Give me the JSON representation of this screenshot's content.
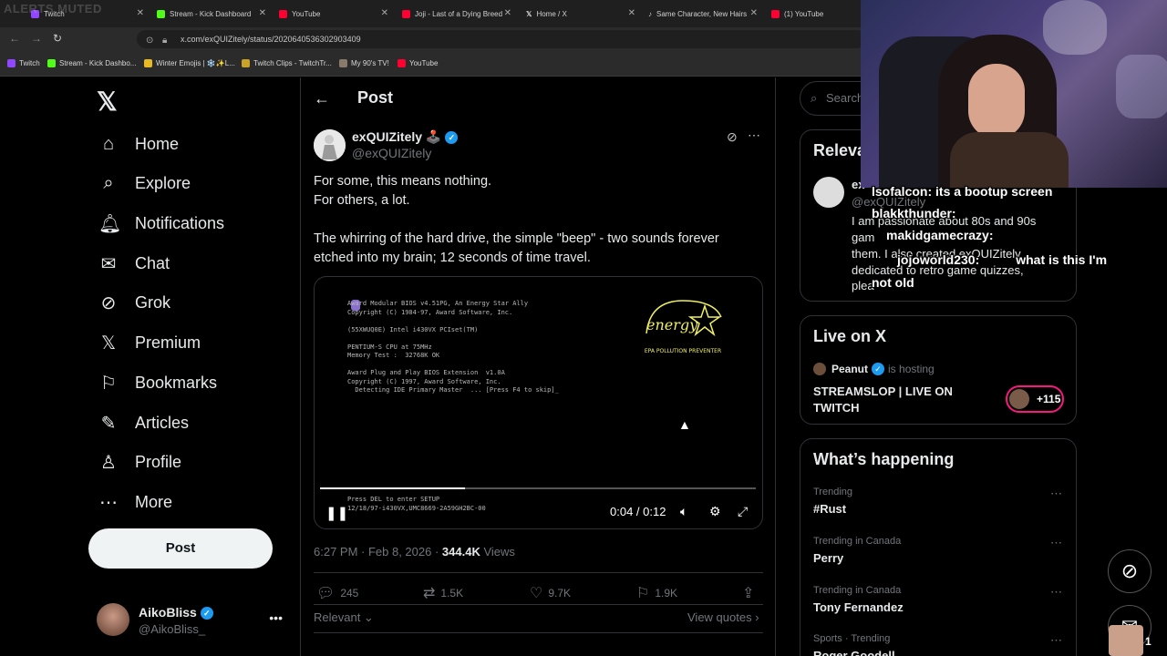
{
  "browser": {
    "tabs": [
      {
        "title": "Twitch",
        "color": "#9146ff"
      },
      {
        "title": "Stream - Kick Dashboard",
        "color": "#53fc18"
      },
      {
        "title": "YouTube",
        "color": "#ff0033"
      },
      {
        "title": "Joji - Last of a Dying Breed",
        "color": "#ff0033"
      },
      {
        "title": "Home / X",
        "color": "#e7e9ea"
      },
      {
        "title": "Same Character, New Hairs",
        "color": "#e7e9ea"
      },
      {
        "title": "(1) YouTube",
        "color": "#ff0033"
      }
    ],
    "url": "x.com/exQUIZitely/status/2020640536302903409",
    "bookmarks": [
      "Twitch",
      "Stream - Kick Dashbo...",
      "Winter Emojis | ❄️✨L...",
      "Twitch Clips - TwitchTr...",
      "My 90's TV!",
      "YouTube"
    ]
  },
  "overlay": {
    "alerts_muted": "ALERTS MUTED",
    "chat": [
      {
        "user": "lsofalcon:",
        "text": " its a bootup screen"
      },
      {
        "user": "blakkthunder:",
        "text": ""
      },
      {
        "user": "makidgamecrazy:",
        "text": ""
      },
      {
        "user": "jojoworld230:",
        "text": "what is this I'm"
      },
      {
        "user": "",
        "text": "not old"
      }
    ],
    "pip_count": "1"
  },
  "nav": {
    "items": [
      {
        "label": "Home",
        "icon": "⌂"
      },
      {
        "label": "Explore",
        "icon": "⌕"
      },
      {
        "label": "Notifications",
        "icon": "🔔︎"
      },
      {
        "label": "Chat",
        "icon": "✉"
      },
      {
        "label": "Grok",
        "icon": "⊘"
      },
      {
        "label": "Premium",
        "icon": "𝕏"
      },
      {
        "label": "Bookmarks",
        "icon": "⚐"
      },
      {
        "label": "Articles",
        "icon": "✎"
      },
      {
        "label": "Profile",
        "icon": "♙"
      },
      {
        "label": "More",
        "icon": "⋯"
      }
    ],
    "post_button": "Post",
    "account": {
      "name": "AikoBliss",
      "handle": "@AikoBliss_"
    }
  },
  "post": {
    "header_title": "Post",
    "author_name": "exQUIZitely 🕹️",
    "author_handle": "@exQUIZitely",
    "lines": [
      "For some, this means nothing.",
      "For others, a lot.",
      "The whirring of the hard drive, the simple \"beep\" - two sounds forever",
      "etched into my brain; 12 seconds of time travel."
    ],
    "video": {
      "bios_top": "Award Modular BIOS v4.51PG, An Energy Star Ally\nCopyright (C) 1984-97, Award Software, Inc.\n\n(55XWUQ0E) Intel i430VX PCIset(TM)\n\nPENTIUM-S CPU at 75MHz\nMemory Test :  32768K OK\n\nAward Plug and Play BIOS Extension  v1.0A\nCopyright (C) 1997, Award Software, Inc.\n  Detecting IDE Primary Master  ... [Press F4 to skip]_",
      "bios_bottom": "Press DEL to enter SETUP\n12/18/97-i430VX,UMC8669-2A59GH2BC-00",
      "energy_label": "EPA POLLUTION PREVENTER",
      "time": "0:04 / 0:12",
      "progress": 0.3333
    },
    "timestamp": "6:27 PM · Feb 8, 2026 · ",
    "views_count": "344.4K",
    "views_label": " Views",
    "actions": {
      "replies": "245",
      "reposts": "1.5K",
      "likes": "9.7K",
      "bookmarks": "1.9K"
    },
    "relevant_label": "Relevant",
    "view_quotes": "View quotes"
  },
  "right": {
    "search_placeholder": "Search",
    "relevant_title": "Relevan",
    "relevant_person": {
      "name": "ex",
      "handle": "@exQUIZitely",
      "bio_lines": [
        "I am passionate about 80s and 90s",
        "gam",
        "them. I also created exQUIZitely",
        "dedicated to retro game quizzes,",
        "plea"
      ]
    },
    "live": {
      "title": "Live on X",
      "host": "Peanut",
      "host_suffix": "is hosting",
      "stream_line1": "STREAMSLOP | LIVE ON",
      "stream_line2": "TWITCH",
      "count": "+115"
    },
    "happening": {
      "title": "What’s happening",
      "trends": [
        {
          "category": "Trending",
          "name": "#Rust"
        },
        {
          "category": "Trending in Canada",
          "name": "Perry"
        },
        {
          "category": "Trending in Canada",
          "name": "Tony Fernandez"
        },
        {
          "category": "Sports · Trending",
          "name": "Roger Goodell"
        }
      ]
    }
  }
}
